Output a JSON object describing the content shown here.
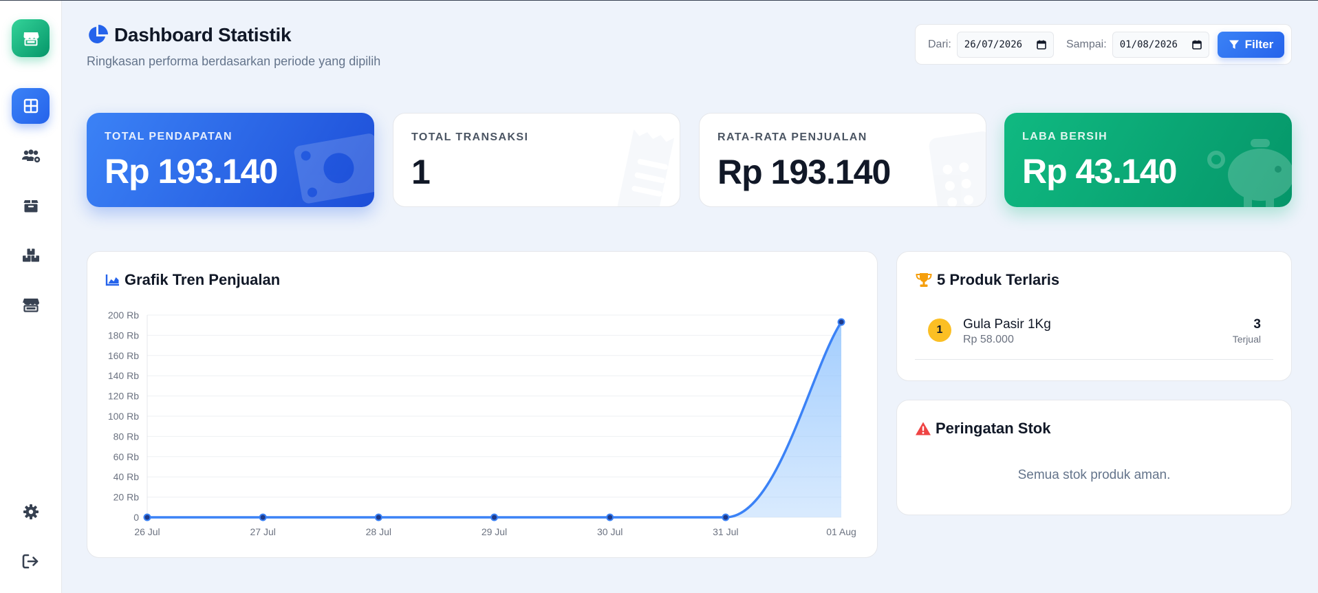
{
  "sidebar": {
    "logo_icon": "store-icon",
    "items": [
      {
        "name": "dashboard",
        "icon": "grid-icon",
        "active": true
      },
      {
        "name": "users",
        "icon": "users-cog-icon",
        "active": false
      },
      {
        "name": "products",
        "icon": "box-icon",
        "active": false
      },
      {
        "name": "stock",
        "icon": "boxes-icon",
        "active": false
      },
      {
        "name": "store",
        "icon": "store-icon",
        "active": false
      }
    ],
    "bottom": [
      {
        "name": "settings",
        "icon": "gear-icon"
      },
      {
        "name": "logout",
        "icon": "logout-icon"
      }
    ],
    "accent": "#2563eb",
    "logo_color": "#10b981"
  },
  "header": {
    "title": "Dashboard Statistik",
    "subtitle": "Ringkasan performa berdasarkan periode yang dipilih",
    "filter": {
      "from_label": "Dari:",
      "from_value": "26/07/2026",
      "to_label": "Sampai:",
      "to_value": "01/08/2026",
      "button_label": "Filter"
    }
  },
  "stats": [
    {
      "label": "TOTAL PENDAPATAN",
      "value": "Rp 193.140",
      "theme": "blue",
      "icon": "money-bill-icon"
    },
    {
      "label": "TOTAL TRANSAKSI",
      "value": "1",
      "theme": "white",
      "icon": "receipt-icon"
    },
    {
      "label": "RATA-RATA PENJUALAN",
      "value": "Rp 193.140",
      "theme": "white",
      "icon": "calculator-icon"
    },
    {
      "label": "LABA BERSIH",
      "value": "Rp 43.140",
      "theme": "green",
      "icon": "piggy-bank-icon"
    }
  ],
  "sales_chart": {
    "title": "Grafik Tren Penjualan",
    "icon": "area-chart-icon"
  },
  "chart_data": {
    "type": "area",
    "title": "Grafik Tren Penjualan",
    "xlabel": "",
    "ylabel": "",
    "categories": [
      "26 Jul",
      "27 Jul",
      "28 Jul",
      "29 Jul",
      "30 Jul",
      "31 Jul",
      "01 Aug"
    ],
    "values": [
      0,
      0,
      0,
      0,
      0,
      0,
      193140
    ],
    "ylim": [
      0,
      200000
    ],
    "yticks": [
      0,
      20000,
      40000,
      60000,
      80000,
      100000,
      120000,
      140000,
      160000,
      180000,
      200000
    ],
    "ytick_labels": [
      "0",
      "20 Rb",
      "40 Rb",
      "60 Rb",
      "80 Rb",
      "100 Rb",
      "120 Rb",
      "140 Rb",
      "160 Rb",
      "180 Rb",
      "200 Rb"
    ],
    "grid": true,
    "line_color": "#3b82f6",
    "fill_color": "#93c5fd",
    "point_color": "#1e3a8a"
  },
  "top_products": {
    "title": "5 Produk Terlaris",
    "icon": "trophy-icon",
    "items": [
      {
        "rank": "1",
        "name": "Gula Pasir 1Kg",
        "price": "Rp 58.000",
        "qty": "3",
        "qty_label": "Terjual"
      }
    ]
  },
  "stock_warning": {
    "title": "Peringatan Stok",
    "icon": "warning-icon",
    "empty_message": "Semua stok produk aman."
  }
}
